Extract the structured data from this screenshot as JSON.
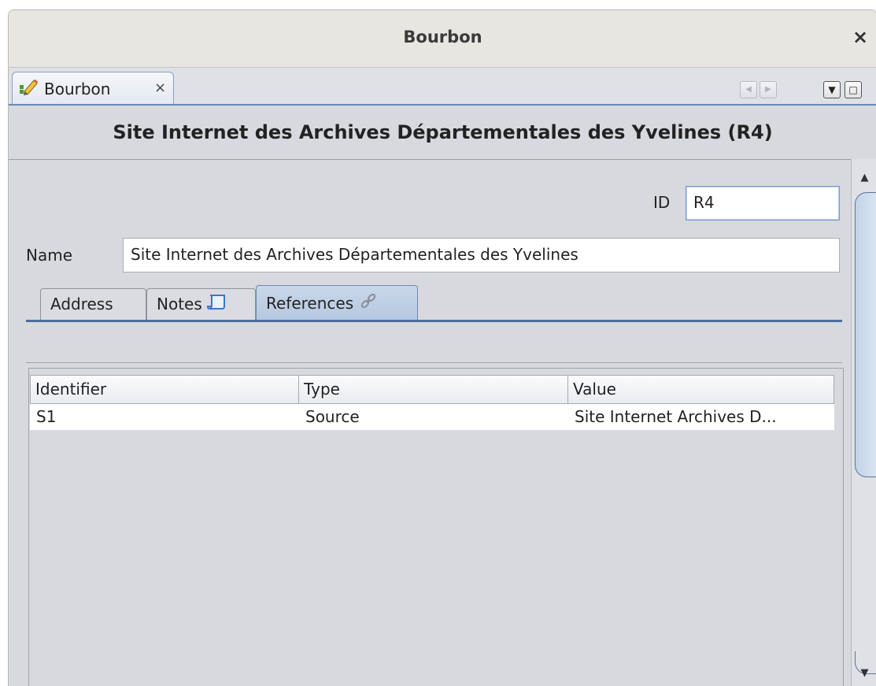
{
  "window": {
    "title": "Bourbon",
    "close_label": "×"
  },
  "doc_tab": {
    "label": "Bourbon",
    "close_label": "×"
  },
  "toolbar": {
    "scroll_left": "◀",
    "scroll_right": "▶",
    "dropdown": "▼",
    "maximize": "□"
  },
  "header": {
    "title": "Site Internet des Archives Départementales des Yvelines (R4)"
  },
  "form": {
    "id_label": "ID",
    "id_value": "R4",
    "name_label": "Name",
    "name_value": "Site Internet des Archives Départementales des Yvelines"
  },
  "tabs": [
    {
      "label": "Address"
    },
    {
      "label": "Notes"
    },
    {
      "label": "References"
    }
  ],
  "table": {
    "columns": [
      "Identifier",
      "Type",
      "Value"
    ],
    "rows": [
      [
        "S1",
        "Source",
        "Site Internet Archives D..."
      ]
    ]
  },
  "icons": {
    "doc_tab_icon": "edit-icon",
    "notes_icon": "note-icon",
    "references_icon": "link-icon"
  },
  "colors": {
    "accent": "#4d6d9a",
    "selected_tab": "#b6c8e0"
  }
}
